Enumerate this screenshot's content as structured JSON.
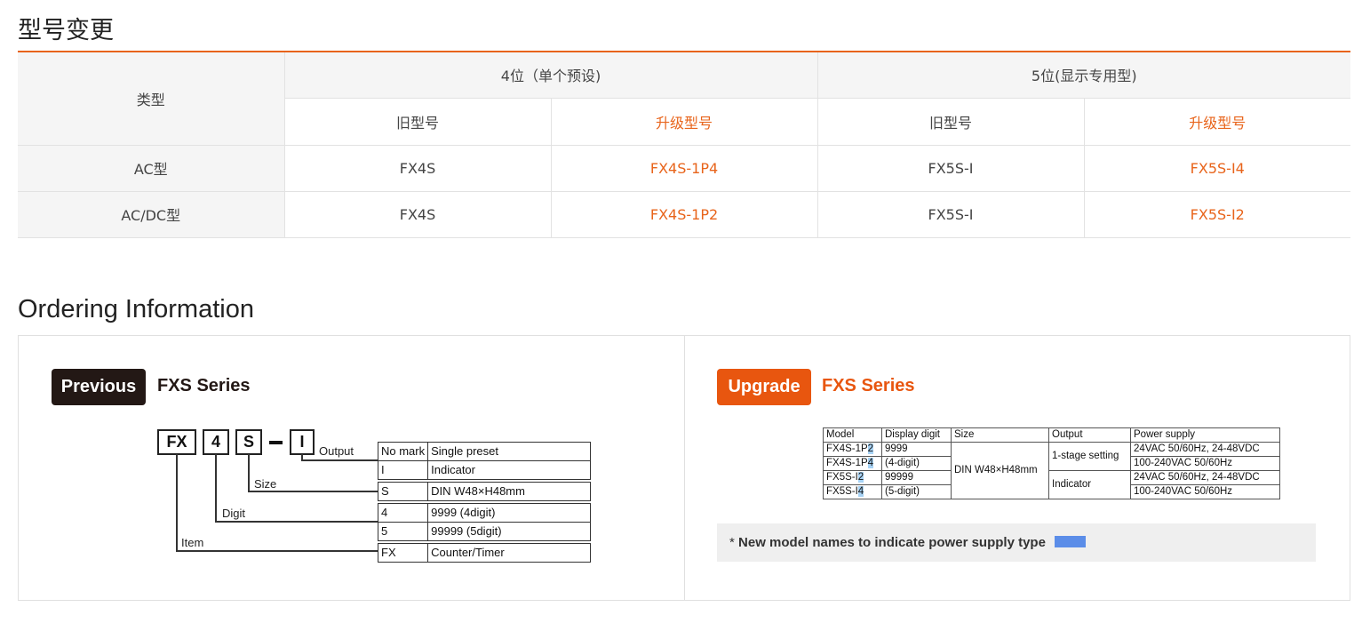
{
  "model_change": {
    "title": "型号变更",
    "type_header": "类型",
    "group_4digit": "4位（单个预设)",
    "group_5digit": "5位(显示专用型)",
    "old_label": "旧型号",
    "new_label": "升级型号",
    "rows": [
      {
        "type": "AC型",
        "old4": "FX4S",
        "new4": "FX4S-1P4",
        "old5": "FX5S-I",
        "new5": "FX5S-I4"
      },
      {
        "type": "AC/DC型",
        "old4": "FX4S",
        "new4": "FX4S-1P2",
        "old5": "FX5S-I",
        "new5": "FX5S-I2"
      }
    ],
    "accent_color": "#e8641b"
  },
  "ordering": {
    "title": "Ordering Information",
    "previous": {
      "badge": "Previous",
      "series": "FXS Series",
      "codes": [
        "FX",
        "4",
        "S",
        "I"
      ],
      "labels": {
        "output": "Output",
        "size": "Size",
        "digit": "Digit",
        "item": "Item"
      },
      "options": [
        [
          "No mark",
          "Single preset"
        ],
        [
          "I",
          "Indicator"
        ],
        [
          "S",
          "DIN W48×H48mm"
        ],
        [
          "4",
          "9999 (4digit)"
        ],
        [
          "5",
          "99999 (5digit)"
        ],
        [
          "FX",
          "Counter/Timer"
        ]
      ]
    },
    "upgrade": {
      "badge": "Upgrade",
      "series": "FXS Series",
      "headers": [
        "Model",
        "Display digit",
        "Size",
        "Output",
        "Power supply"
      ],
      "models": [
        {
          "base": "FX4S-1P",
          "suffix": "2"
        },
        {
          "base": "FX4S-1P",
          "suffix": "4"
        },
        {
          "base": "FX5S-I",
          "suffix": "2"
        },
        {
          "base": "FX5S-I",
          "suffix": "4"
        }
      ],
      "digits": [
        "9999",
        "(4-digit)",
        "99999",
        "(5-digit)"
      ],
      "size": "DIN W48×H48mm",
      "outputs": [
        "1-stage setting",
        "Indicator"
      ],
      "power": [
        "24VAC 50/60Hz, 24-48VDC",
        "100-240VAC 50/60Hz",
        "24VAC 50/60Hz, 24-48VDC",
        "100-240VAC 50/60Hz"
      ],
      "note": "New model names to indicate power supply type",
      "note_star": "*",
      "swatch_color": "#5b8de8",
      "highlight_color": "#a6d2f5"
    },
    "badge_previous_color": "#231815",
    "badge_upgrade_color": "#e8560f"
  }
}
